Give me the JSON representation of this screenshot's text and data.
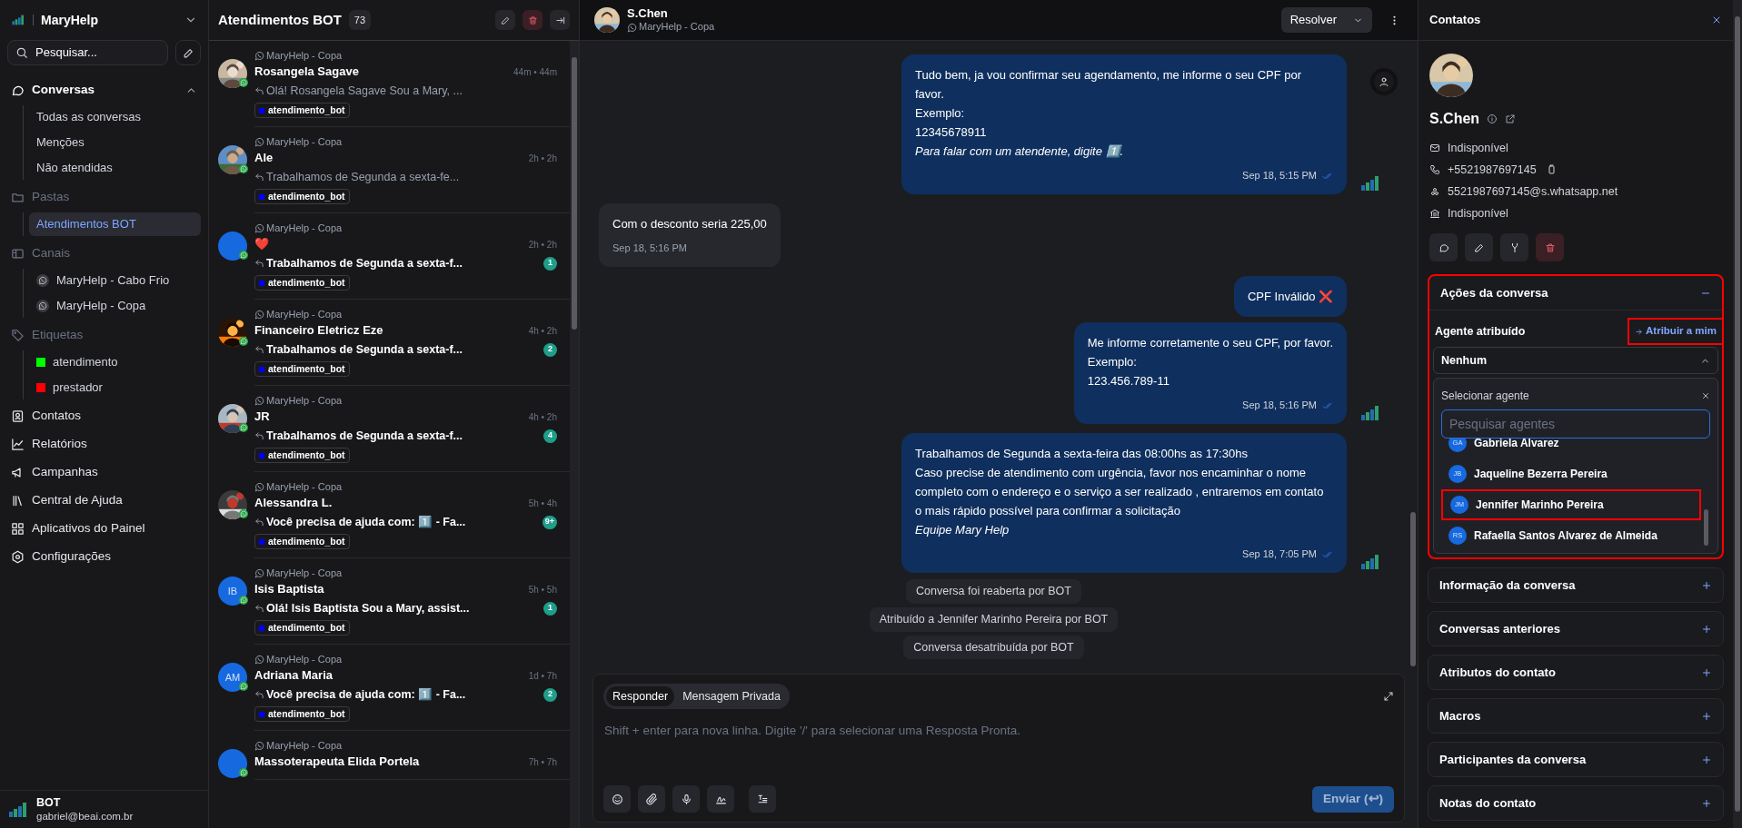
{
  "sidebar": {
    "brand": "MaryHelp",
    "search": "Pesquisar...",
    "nav": [
      {
        "kind": "menu",
        "label": "Conversas",
        "expanded": true,
        "children": [
          {
            "kind": "item",
            "label": "Todas as conversas",
            "selected": false
          },
          {
            "kind": "item",
            "label": "Menções",
            "selected": false
          },
          {
            "kind": "item",
            "label": "Não atendidas",
            "selected": false
          }
        ]
      },
      {
        "kind": "group",
        "label": "Pastas",
        "children": [
          {
            "kind": "item",
            "label": "Atendimentos BOT",
            "selected": true
          }
        ]
      },
      {
        "kind": "group",
        "label": "Canais",
        "children": [
          {
            "kind": "channel",
            "label": "MaryHelp - Cabo Frio",
            "selected": false
          },
          {
            "kind": "channel",
            "label": "MaryHelp - Copa",
            "selected": false
          }
        ]
      },
      {
        "kind": "group",
        "label": "Etiquetas",
        "children": [
          {
            "kind": "tag",
            "label": "atendimento",
            "color": "#00ff00",
            "selected": false
          },
          {
            "kind": "tag",
            "label": "prestador",
            "color": "#ff0000",
            "selected": false
          }
        ]
      },
      {
        "kind": "link",
        "label": "Contatos"
      },
      {
        "kind": "link",
        "label": "Relatórios"
      },
      {
        "kind": "link",
        "label": "Campanhas"
      },
      {
        "kind": "link",
        "label": "Central de Ajuda"
      },
      {
        "kind": "link",
        "label": "Aplicativos do Painel"
      },
      {
        "kind": "link",
        "label": "Configurações"
      }
    ],
    "user": {
      "name": "BOT",
      "email": "gabriel@beai.com.br"
    }
  },
  "conversation_list": {
    "title": "Atendimentos BOT",
    "count": "73",
    "items": [
      {
        "channel": "MaryHelp - Copa",
        "name": "Rosangela Sagave",
        "avatar": {
          "kind": "picture"
        },
        "time": "44m • 44m",
        "preview": "Olá! Rosangela Sagave Sou a Mary, ...",
        "tags": [
          {
            "label": "atendimento_bot",
            "color": "#0000ff"
          }
        ]
      },
      {
        "channel": "MaryHelp - Copa",
        "name": "Ale",
        "avatar": {
          "kind": "picture"
        },
        "time": "2h • 2h",
        "preview": "Trabalhamos de Segunda a sexta-fe...",
        "tags": [
          {
            "label": "atendimento_bot",
            "color": "#0000ff"
          }
        ]
      },
      {
        "channel": "MaryHelp - Copa",
        "name": "❤️",
        "avatar": {
          "kind": "plain"
        },
        "time": "2h • 2h",
        "preview": "Trabalhamos de Segunda a sexta-f...",
        "unread": "1",
        "tags": [
          {
            "label": "atendimento_bot",
            "color": "#0000ff"
          }
        ]
      },
      {
        "channel": "MaryHelp - Copa",
        "name": "Financeiro Eletricz Eze",
        "avatar": {
          "kind": "picture"
        },
        "time": "4h • 2h",
        "preview": "Trabalhamos de Segunda a sexta-f...",
        "unread": "2",
        "tags": [
          {
            "label": "atendimento_bot",
            "color": "#0000ff"
          }
        ]
      },
      {
        "channel": "MaryHelp - Copa",
        "name": "JR",
        "avatar": {
          "kind": "picture"
        },
        "time": "4h • 2h",
        "preview": "Trabalhamos de Segunda a sexta-f...",
        "unread": "4",
        "tags": [
          {
            "label": "atendimento_bot",
            "color": "#0000ff"
          }
        ]
      },
      {
        "channel": "MaryHelp - Copa",
        "name": "Alessandra L.",
        "avatar": {
          "kind": "picture"
        },
        "time": "5h • 4h",
        "preview": "Você precisa de ajuda com: 1️⃣ - Fa...",
        "unread": "9+",
        "tags": [
          {
            "label": "atendimento_bot",
            "color": "#0000ff"
          }
        ]
      },
      {
        "channel": "MaryHelp - Copa",
        "name": "Isis Baptista",
        "avatar": {
          "kind": "initials",
          "initials": "IB"
        },
        "time": "5h • 5h",
        "preview": "Olá! Isis Baptista Sou a Mary, assist...",
        "unread": "1",
        "tags": [
          {
            "label": "atendimento_bot",
            "color": "#0000ff"
          }
        ]
      },
      {
        "channel": "MaryHelp - Copa",
        "name": "Adriana Maria",
        "avatar": {
          "kind": "initials",
          "initials": "AM"
        },
        "time": "1d • 7h",
        "preview": "Você precisa de ajuda com: 1️⃣ - Fa...",
        "unread": "2",
        "tags": [
          {
            "label": "atendimento_bot",
            "color": "#0000ff"
          }
        ]
      },
      {
        "channel": "MaryHelp - Copa",
        "name": "Massoterapeuta Elida Portela",
        "avatar": {
          "kind": "plain"
        },
        "time": "7h • 7h"
      }
    ]
  },
  "chat": {
    "contact": {
      "name": "S.Chen",
      "channel": "MaryHelp - Copa"
    },
    "resolve_button": "Resolver",
    "messages": [
      {
        "kind": "outgoing",
        "lines": [
          "Tudo bem, ja vou confirmar seu agendamento, me informe o seu CPF por favor.",
          "Exemplo:",
          "12345678911",
          "*Para falar com um atendente, digite 1️⃣.*"
        ],
        "time": "Sep 18, 5:15 PM"
      },
      {
        "kind": "incoming",
        "lines": [
          "Com o desconto seria 225,00"
        ],
        "time": "Sep 18, 5:16 PM"
      },
      {
        "kind": "outgoing",
        "lines": [
          "CPF Inválido ❌"
        ]
      },
      {
        "kind": "outgoing",
        "lines": [
          "Me informe corretamente o seu CPF, por favor.",
          "Exemplo:",
          "123.456.789-11"
        ],
        "time": "Sep 18, 5:16 PM"
      },
      {
        "kind": "outgoing",
        "lines": [
          "Trabalhamos de Segunda a sexta-feira das 08:00hs as 17:30hs",
          "Caso precise de atendimento com urgência, favor nos encaminhar o nome completo com o endereço e o serviço a ser realizado , entraremos em contato o mais rápido possível para confirmar a solicitação",
          "*Equipe Mary Help*"
        ],
        "time": "Sep 18, 7:05 PM"
      },
      {
        "kind": "activity",
        "lines": [
          "Conversa foi reaberta por BOT"
        ]
      },
      {
        "kind": "activity",
        "lines": [
          "Atribuído a Jennifer Marinho Pereira por BOT"
        ]
      },
      {
        "kind": "activity",
        "lines": [
          "Conversa desatribuída por BOT"
        ]
      }
    ],
    "composer": {
      "tabs": [
        {
          "label": "Responder",
          "selected": true
        },
        {
          "label": "Mensagem Privada",
          "selected": false
        }
      ],
      "placeholder": "Shift + enter para nova linha. Digite '/' para selecionar uma Resposta Pronta.",
      "send": {
        "label": "Enviar (↩)",
        "disabled": true
      }
    }
  },
  "contact_panel": {
    "title": "Contatos",
    "name": "S.Chen",
    "details": [
      "Indisponível",
      "+5521987697145",
      "5521987697145@s.whatsapp.net",
      "Indisponível"
    ],
    "sections": [
      {
        "title": "Ações da conversa",
        "expanded": true,
        "highlighted": true,
        "agent": {
          "label": "Agente atribuído",
          "assign_link": {
            "label": "Atribuir a mim",
            "highlighted": true
          },
          "value": "Nenhum",
          "open": true,
          "dropdown": {
            "title": "Selecionar agente",
            "placeholder": "Pesquisar agentes",
            "agents": [
              {
                "initials": "GA",
                "name": "Gabriela Alvarez",
                "highlighted": false
              },
              {
                "initials": "JB",
                "name": "Jaqueline Bezerra Pereira",
                "highlighted": false
              },
              {
                "initials": "JM",
                "name": "Jennifer Marinho Pereira",
                "highlighted": true
              },
              {
                "initials": "RS",
                "name": "Rafaella Santos Alvarez de Almeida",
                "highlighted": false
              }
            ]
          }
        }
      },
      {
        "title": "Informação da conversa",
        "expanded": false,
        "highlighted": false
      },
      {
        "title": "Conversas anteriores",
        "expanded": false,
        "highlighted": false
      },
      {
        "title": "Atributos do contato",
        "expanded": false,
        "highlighted": false
      },
      {
        "title": "Macros",
        "expanded": false,
        "highlighted": false
      },
      {
        "title": "Participantes da conversa",
        "expanded": false,
        "highlighted": false
      },
      {
        "title": "Notas do contato",
        "expanded": false,
        "highlighted": false
      }
    ]
  }
}
